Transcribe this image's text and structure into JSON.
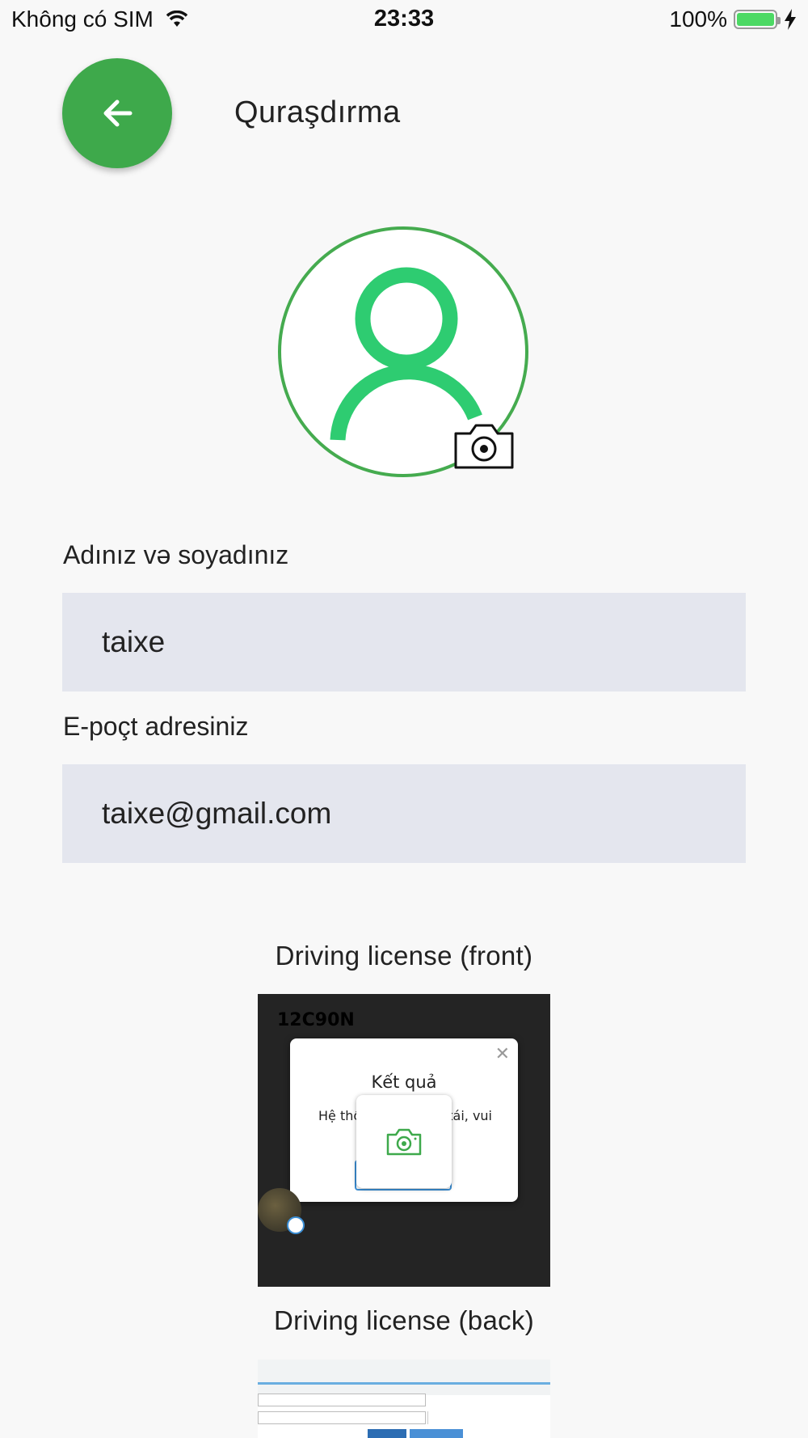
{
  "status_bar": {
    "carrier": "Không có SIM",
    "time": "23:33",
    "battery": "100%",
    "battery_level": 1.0
  },
  "header": {
    "title": "Quraşdırma"
  },
  "form": {
    "name_label": "Adınız və soyadınız",
    "name_value": "taixe",
    "email_label": "E-poçt adresiniz",
    "email_value": "taixe@gmail.com"
  },
  "license": {
    "front_label": "Driving license (front)",
    "back_label": "Driving license (back)",
    "front_image": {
      "header_text": "12C90N",
      "dialog_title": "Kết quả",
      "dialog_text_left": "Hệ thố",
      "dialog_text_right": "tái, vui"
    }
  },
  "colors": {
    "accent_green": "#3ea94b",
    "avatar_icon_green": "#2ecc71",
    "input_background": "#e4e6ee",
    "page_background": "#f8f8f8"
  }
}
